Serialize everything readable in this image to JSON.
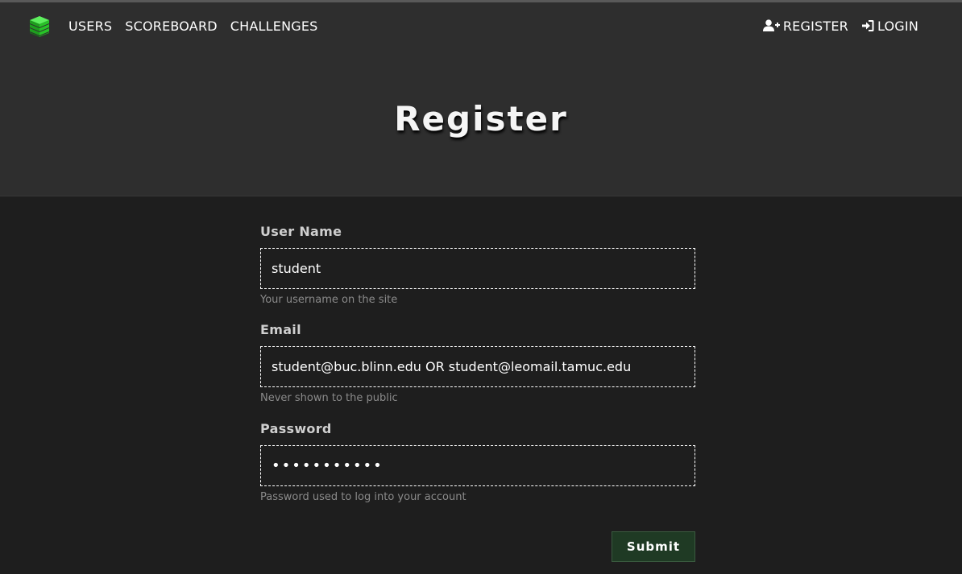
{
  "nav": {
    "logo_icon": "green-stacked-cube-logo",
    "left_links": [
      "USERS",
      "SCOREBOARD",
      "CHALLENGES"
    ],
    "register": {
      "label": "REGISTER",
      "icon": "user-plus-icon"
    },
    "login": {
      "label": "LOGIN",
      "icon": "sign-in-icon"
    }
  },
  "page": {
    "title": "Register"
  },
  "form": {
    "username": {
      "label": "User Name",
      "value": "student",
      "help": "Your username on the site"
    },
    "email": {
      "label": "Email",
      "value": "student@buc.blinn.edu OR student@leomail.tamuc.edu",
      "help": "Never shown to the public"
    },
    "password": {
      "label": "Password",
      "value": "•••••••••••",
      "help": "Password used to log into your account"
    },
    "submit_label": "Submit"
  },
  "colors": {
    "header_bg": "#2e2e2e",
    "body_bg": "#1e1e1e",
    "submit_bg": "#1f3a24",
    "logo_green": "#2bd22b"
  }
}
